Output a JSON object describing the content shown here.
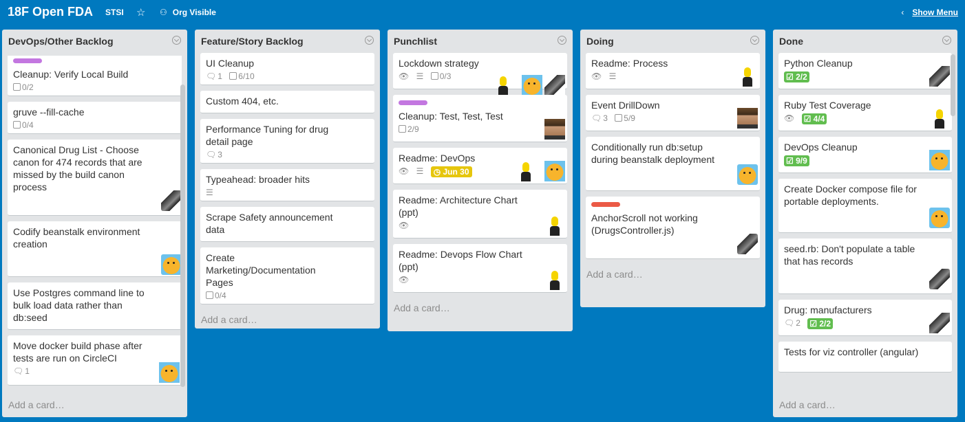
{
  "header": {
    "board_title": "18F Open FDA",
    "team": "STSI",
    "star_icon": "star-icon",
    "visibility": "Org Visible",
    "show_menu": "Show Menu"
  },
  "colors": {
    "background": "#0079bf",
    "list_bg": "#e2e4e6",
    "label_purple": "#c377e0",
    "label_red": "#eb5a46",
    "badge_green": "#61bd4f",
    "badge_yellow": "#e6c60d"
  },
  "add_card_label": "Add a card…",
  "lists": [
    {
      "title": "DevOps/Other Backlog",
      "cards": [
        {
          "title": "Cleanup: Verify Local Build",
          "label": "purple",
          "checklist": "0/2"
        },
        {
          "title": "gruve --fill-cache",
          "checklist": "0/4"
        },
        {
          "title": "Canonical Drug List - Choose canon for 474 records that are missed by the build canon process",
          "avatar": "bw"
        },
        {
          "title": "Codify beanstalk environment creation",
          "avatar": "jake"
        },
        {
          "title": "Use Postgres command line to bulk load data rather than db:seed"
        },
        {
          "title": "Move docker build phase after tests are run on CircleCI",
          "comments": "1",
          "avatar": "jake"
        }
      ]
    },
    {
      "title": "Feature/Story Backlog",
      "cards": [
        {
          "title": "UI Cleanup",
          "comments": "1",
          "checklist": "6/10"
        },
        {
          "title": "Custom 404, etc."
        },
        {
          "title": "Performance Tuning for drug detail page",
          "comments": "3"
        },
        {
          "title": "Typeahead: broader hits",
          "description": true
        },
        {
          "title": "Scrape Safety announcement data"
        },
        {
          "title": "Create Marketing/Documentation Pages",
          "checklist": "0/4"
        }
      ]
    },
    {
      "title": "Punchlist",
      "cards": [
        {
          "title": "Lockdown strategy",
          "watch": true,
          "description": true,
          "checklist": "0/3"
        },
        {
          "title": "Cleanup: Test, Test, Test",
          "label": "purple",
          "checklist": "2/9"
        },
        {
          "title": "Readme: DevOps",
          "watch": true,
          "description": true,
          "due": "Jun 30"
        },
        {
          "title": "Readme: Architecture Chart (ppt)",
          "watch": true
        },
        {
          "title": "Readme: Devops Flow Chart (ppt)",
          "watch": true
        }
      ]
    },
    {
      "title": "Doing",
      "cards": [
        {
          "title": "Readme: Process",
          "watch": true,
          "description": true
        },
        {
          "title": "Event DrillDown",
          "comments": "3",
          "checklist": "5/9"
        },
        {
          "title": "Conditionally run db:setup during beanstalk deployment"
        },
        {
          "title": "AnchorScroll not working (DrugsController.js)",
          "label": "red"
        }
      ]
    },
    {
      "title": "Done",
      "cards": [
        {
          "title": "Python Cleanup",
          "checklist_done": "2/2"
        },
        {
          "title": "Ruby Test Coverage",
          "watch": true,
          "checklist_done": "4/4"
        },
        {
          "title": "DevOps Cleanup",
          "checklist_done": "9/9"
        },
        {
          "title": "Create Docker compose file for portable deployments."
        },
        {
          "title": "seed.rb: Don't populate a table that has records"
        },
        {
          "title": "Drug: manufacturers",
          "comments": "2",
          "checklist_done": "2/2"
        },
        {
          "title": "Tests for viz controller (angular)"
        }
      ]
    }
  ]
}
